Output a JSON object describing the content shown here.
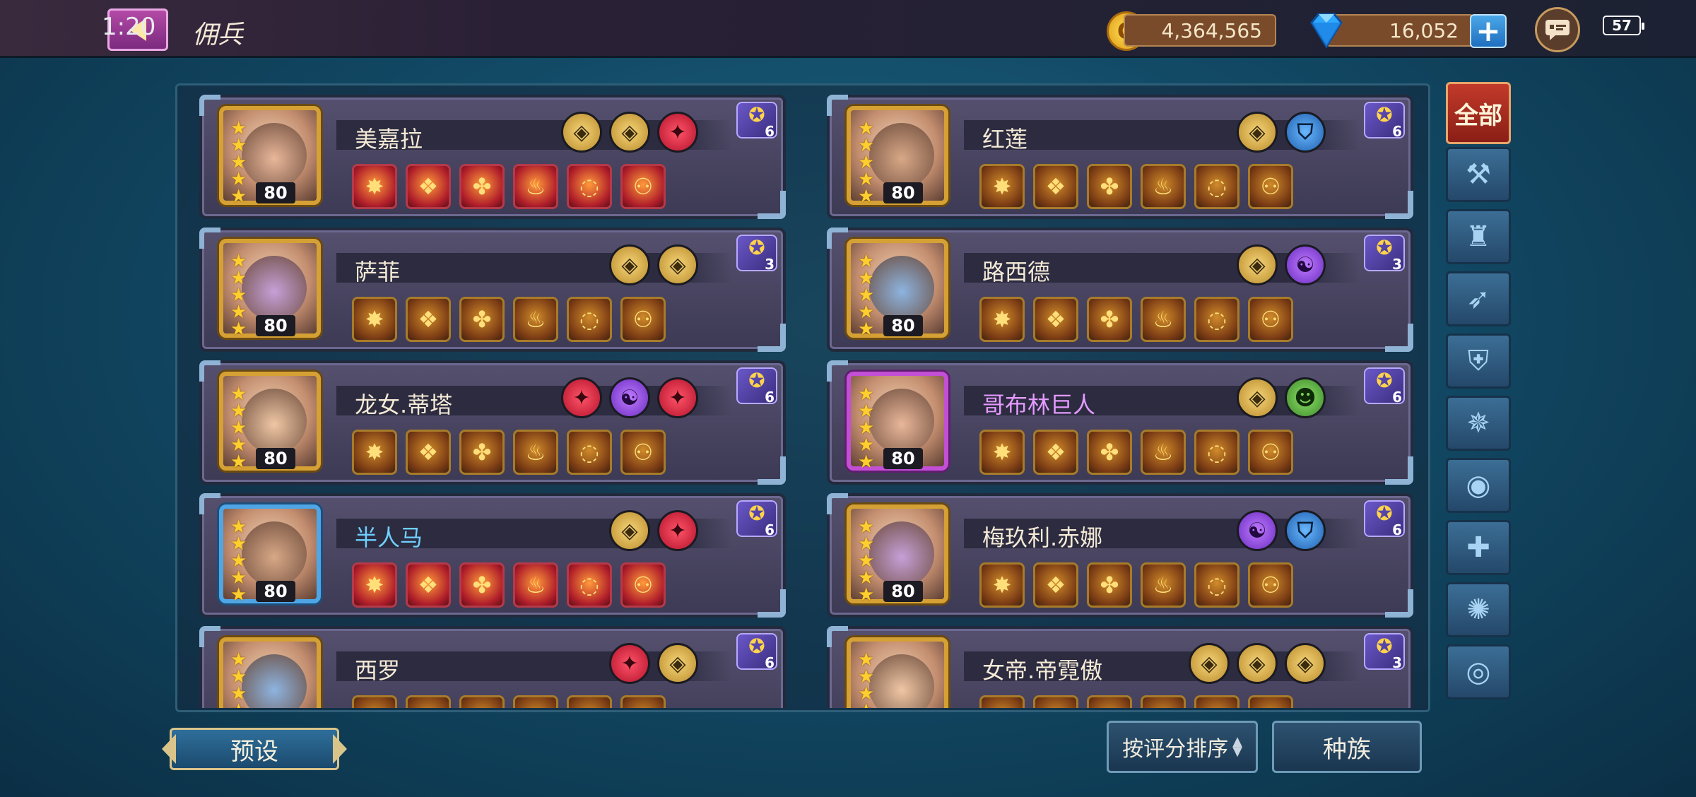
{
  "status": {
    "time": "1:20",
    "battery": "57"
  },
  "header": {
    "title": "佣兵",
    "gold": "4,364,565",
    "gems": "16,052"
  },
  "filters": {
    "all_label": "全部",
    "icons": [
      "hammer-icon",
      "robe-icon",
      "bow-icon",
      "shield-icon",
      "shuriken-icon",
      "eye-icon",
      "cross-icon",
      "spiral-icon",
      "circle-target-icon"
    ]
  },
  "heroes": [
    {
      "name": "美嘉拉",
      "level": "80",
      "stars": 5,
      "frame": "gold",
      "name_color": "white",
      "badge": "6",
      "traits": [
        "gold",
        "gold",
        "red"
      ]
    },
    {
      "name": "红莲",
      "level": "80",
      "stars": 5,
      "frame": "gold",
      "name_color": "white",
      "badge": "6",
      "traits": [
        "gold",
        "blue"
      ]
    },
    {
      "name": "萨菲",
      "level": "80",
      "stars": 5,
      "frame": "gold",
      "name_color": "white",
      "badge": "3",
      "traits": [
        "gold",
        "gold"
      ]
    },
    {
      "name": "路西德",
      "level": "80",
      "stars": 5,
      "frame": "gold",
      "name_color": "white",
      "badge": "3",
      "traits": [
        "gold",
        "purple"
      ]
    },
    {
      "name": "龙女.蒂塔",
      "level": "80",
      "stars": 5,
      "frame": "gold",
      "name_color": "white",
      "badge": "6",
      "traits": [
        "red",
        "purple",
        "red"
      ]
    },
    {
      "name": "哥布林巨人",
      "level": "80",
      "stars": 5,
      "frame": "purple",
      "name_color": "purple",
      "badge": "6",
      "traits": [
        "gold",
        "green"
      ]
    },
    {
      "name": "半人马",
      "level": "80",
      "stars": 5,
      "frame": "blue",
      "name_color": "blue",
      "badge": "6",
      "traits": [
        "gold",
        "red"
      ]
    },
    {
      "name": "梅玖利.赤娜",
      "level": "80",
      "stars": 5,
      "frame": "gold",
      "name_color": "white",
      "badge": "6",
      "traits": [
        "purple",
        "blue"
      ]
    },
    {
      "name": "西罗",
      "level": "",
      "stars": 5,
      "frame": "gold",
      "name_color": "white",
      "badge": "6",
      "traits": [
        "red",
        "gold"
      ]
    },
    {
      "name": "女帝.帝霓傲",
      "level": "",
      "stars": 5,
      "frame": "gold",
      "name_color": "white",
      "badge": "3",
      "traits": [
        "gold",
        "gold",
        "gold"
      ]
    }
  ],
  "bottom": {
    "preset": "预设",
    "sort": "按评分排序",
    "race": "种族"
  }
}
